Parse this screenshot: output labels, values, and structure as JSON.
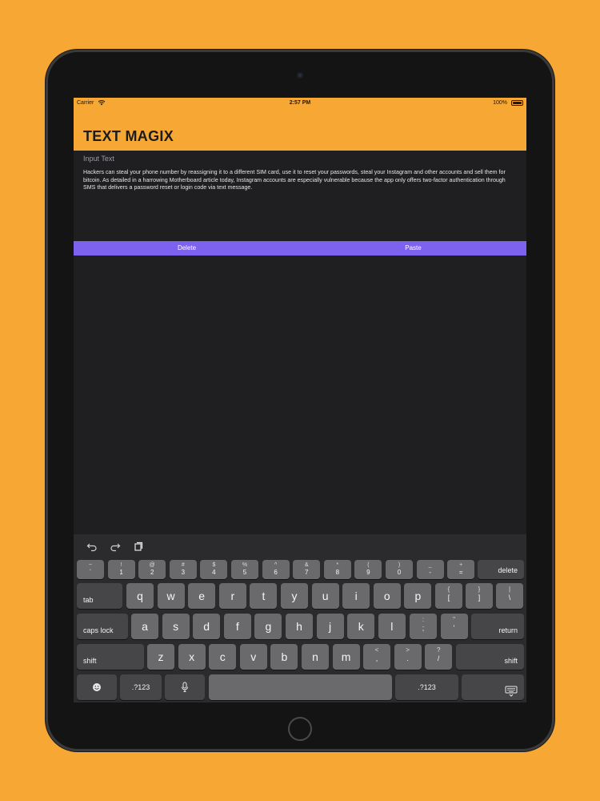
{
  "status": {
    "carrier": "Carrier",
    "time": "2:57 PM",
    "battery": "100%"
  },
  "app": {
    "title": "TEXT MAGIX"
  },
  "input": {
    "label": "Input Text",
    "text": "Hackers can steal your phone number by reassigning it to a different SIM card, use it to reset your passwords, steal your Instagram  and other accounts and sell them for bitcoin. As detailed in a harrowing Motherboard article today, Instagram accounts are especially vulnerable because the app only offers two-factor authentication through SMS that delivers a password reset or login code via text message."
  },
  "actions": {
    "delete_label": "Delete",
    "paste_label": "Paste"
  },
  "colors": {
    "background": "#F7A733",
    "header": "#F7A733",
    "action_bar": "#7D62F0",
    "screen": "#1F1F22"
  },
  "keyboard": {
    "toolbar_icons": [
      "undo-icon",
      "redo-icon",
      "paste-clipboard-icon"
    ],
    "number_row": [
      {
        "top": "~",
        "bot": "`"
      },
      {
        "top": "!",
        "bot": "1"
      },
      {
        "top": "@",
        "bot": "2"
      },
      {
        "top": "#",
        "bot": "3"
      },
      {
        "top": "$",
        "bot": "4"
      },
      {
        "top": "%",
        "bot": "5"
      },
      {
        "top": "^",
        "bot": "6"
      },
      {
        "top": "&",
        "bot": "7"
      },
      {
        "top": "*",
        "bot": "8"
      },
      {
        "top": "(",
        "bot": "9"
      },
      {
        "top": ")",
        "bot": "0"
      },
      {
        "top": "_",
        "bot": "-"
      },
      {
        "top": "+",
        "bot": "="
      }
    ],
    "delete_label": "delete",
    "tab_label": "tab",
    "row_q": [
      "q",
      "w",
      "e",
      "r",
      "t",
      "y",
      "u",
      "i",
      "o",
      "p"
    ],
    "row_q_symbols": [
      {
        "top": "{",
        "bot": "["
      },
      {
        "top": "}",
        "bot": "]"
      },
      {
        "top": "|",
        "bot": "\\"
      }
    ],
    "caps_label": "caps lock",
    "row_a": [
      "a",
      "s",
      "d",
      "f",
      "g",
      "h",
      "j",
      "k",
      "l"
    ],
    "row_a_symbols": [
      {
        "top": ":",
        "bot": ";"
      },
      {
        "top": "\"",
        "bot": "'"
      }
    ],
    "return_label": "return",
    "shift_label": "shift",
    "row_z": [
      "z",
      "x",
      "c",
      "v",
      "b",
      "n",
      "m"
    ],
    "row_z_symbols": [
      {
        "top": "<",
        "bot": ","
      },
      {
        "top": ">",
        "bot": "."
      },
      {
        "top": "?",
        "bot": "/"
      }
    ],
    "numbers_label": ".?123"
  }
}
